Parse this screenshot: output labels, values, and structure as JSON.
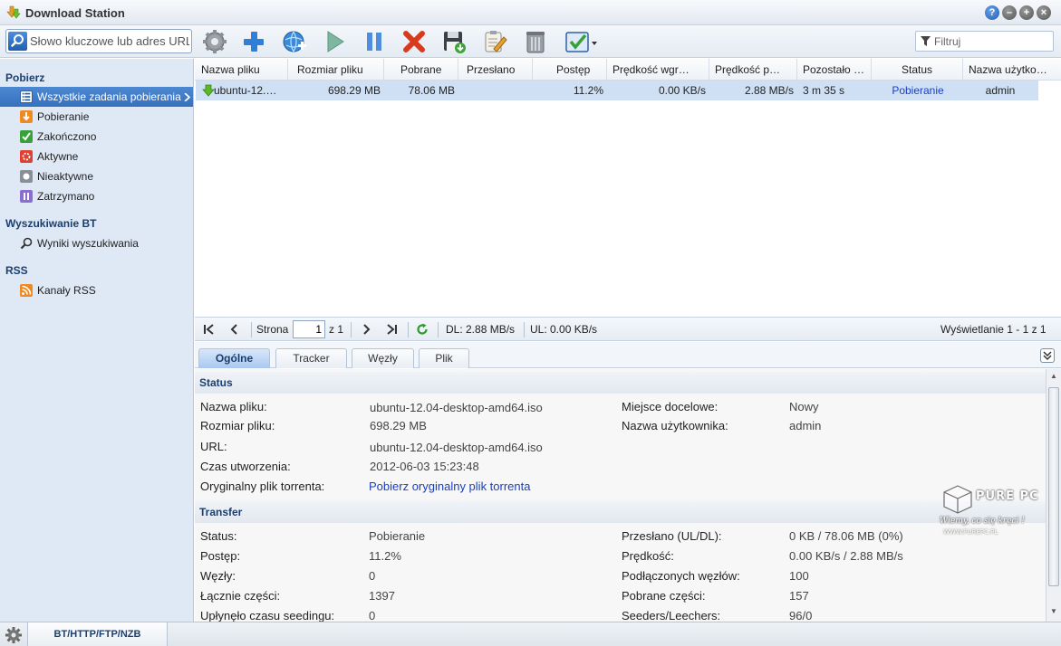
{
  "app": {
    "title": "Download Station"
  },
  "window_buttons": {
    "help": "?",
    "minimize": "–",
    "maximize": "+",
    "close": "×"
  },
  "search": {
    "placeholder": "Słowo kluczowe lub adres URL",
    "value": ""
  },
  "toolbar": {
    "buttons": [
      "gear",
      "add",
      "add-url",
      "resume",
      "pause",
      "delete",
      "save",
      "edit",
      "clean-up",
      "select-all"
    ],
    "filter_placeholder": "Filtruj"
  },
  "sidebar": {
    "sections": [
      {
        "title": "Pobierz",
        "items": [
          {
            "label": "Wszystkie zadania pobierania",
            "icon": "list-icon",
            "selected": true
          },
          {
            "label": "Pobieranie",
            "icon": "download-icon"
          },
          {
            "label": "Zakończono",
            "icon": "check-icon"
          },
          {
            "label": "Aktywne",
            "icon": "active-icon"
          },
          {
            "label": "Nieaktywne",
            "icon": "inactive-icon"
          },
          {
            "label": "Zatrzymano",
            "icon": "paused-icon"
          }
        ]
      },
      {
        "title": "Wyszukiwanie BT",
        "items": [
          {
            "label": "Wyniki wyszukiwania",
            "icon": "magnifier-icon"
          }
        ]
      },
      {
        "title": "RSS",
        "items": [
          {
            "label": "Kanały RSS",
            "icon": "rss-icon"
          }
        ]
      }
    ]
  },
  "grid": {
    "columns": [
      "Nazwa pliku",
      "Rozmiar pliku",
      "Pobrane",
      "Przesłano",
      "Postęp",
      "Prędkość wgr…",
      "Prędkość p…",
      "Pozostało …",
      "Status",
      "Nazwa użytko…"
    ],
    "rows": [
      {
        "name": "ubuntu-12.…",
        "size": "698.29 MB",
        "downloaded": "78.06 MB",
        "uploaded": "",
        "progress": "11.2%",
        "up_speed": "0.00 KB/s",
        "down_speed": "2.88 MB/s",
        "remaining": "3 m 35 s",
        "status": "Pobieranie",
        "user": "admin"
      }
    ]
  },
  "pager": {
    "page_label": "Strona",
    "page_value": "1",
    "of_label": "z 1",
    "dl": "DL: 2.88 MB/s",
    "ul": "UL: 0.00 KB/s",
    "displaying": "Wyświetlanie 1 - 1 z 1"
  },
  "detail_tabs": [
    "Ogólne",
    "Tracker",
    "Węzły",
    "Plik"
  ],
  "details": {
    "status_section": {
      "title": "Status",
      "labels": {
        "file_name": "Nazwa pliku:",
        "file_size": "Rozmiar pliku:",
        "url": "URL:",
        "created": "Czas utworzenia:",
        "original_torrent": "Oryginalny plik torrenta:",
        "destination": "Miejsce docelowe:",
        "user": "Nazwa użytkownika:"
      },
      "values": {
        "file_name": "ubuntu-12.04-desktop-amd64.iso",
        "file_size": "698.29 MB",
        "url": "ubuntu-12.04-desktop-amd64.iso",
        "created": "2012-06-03 15:23:48",
        "original_torrent": "Pobierz oryginalny plik torrenta",
        "destination": "Nowy",
        "user": "admin"
      }
    },
    "transfer_section": {
      "title": "Transfer",
      "labels": {
        "status": "Status:",
        "progress": "Postęp:",
        "peers": "Węzły:",
        "total_pieces": "Łącznie części:",
        "seeding_time": "Upłynęło czasu seedingu:",
        "transferred": "Przesłano (UL/DL):",
        "speed": "Prędkość:",
        "connected_peers": "Podłączonych węzłów:",
        "downloaded_pieces": "Pobrane części:",
        "seeders_leechers": "Seeders/Leechers:"
      },
      "values": {
        "status": "Pobieranie",
        "progress": "11.2%",
        "peers": "0",
        "total_pieces": "1397",
        "seeding_time": "0",
        "transferred": "0 KB / 78.06 MB (0%)",
        "speed": "0.00 KB/s / 2.88 MB/s",
        "connected_peers": "100",
        "downloaded_pieces": "157",
        "seeders_leechers": "96/0"
      }
    }
  },
  "bottom": {
    "tab_label": "BT/HTTP/FTP/NZB"
  },
  "watermark": {
    "brand": "PURE PC",
    "motto": "Wiemy, co się kręci !",
    "url": "WWW.PUREPC.PL"
  },
  "colors": {
    "accent": "#3570bd",
    "selection": "#cfe0f5",
    "link": "#1a3fc0",
    "section_title": "#1c3f6e"
  }
}
